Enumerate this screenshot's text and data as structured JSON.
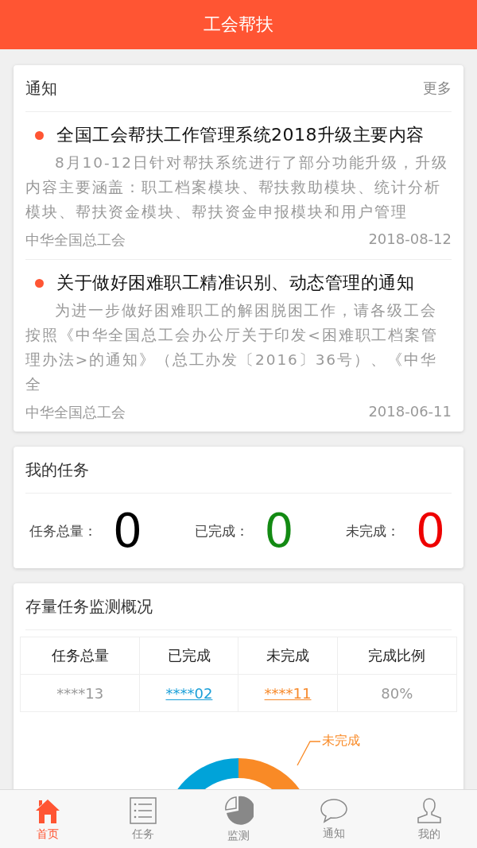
{
  "header": {
    "title": "工会帮扶"
  },
  "notices": {
    "title": "通知",
    "more": "更多",
    "items": [
      {
        "title": "全国工会帮扶工作管理系统2018升级主要内容",
        "summary": "8月10-12日针对帮扶系统进行了部分功能升级，升级内容主要涵盖：职工档案模块、帮扶救助模块、统计分析模块、帮扶资金模块、帮扶资金申报模块和用户管理",
        "source": "中华全国总工会",
        "date": "2018-08-12"
      },
      {
        "title": "关于做好困难职工精准识别、动态管理的通知",
        "summary": "为进一步做好困难职工的解困脱困工作，请各级工会按照《中华全国总工会办公厅关于印发<困难职工档案管理办法>的通知》（总工办发〔2016〕36号）、《中华全",
        "source": "中华全国总工会",
        "date": "2018-06-11"
      }
    ]
  },
  "my_tasks": {
    "title": "我的任务",
    "stats": [
      {
        "label": "任务总量：",
        "value": "0",
        "color": "#000000"
      },
      {
        "label": "已完成：",
        "value": "0",
        "color": "#138a13"
      },
      {
        "label": "未完成：",
        "value": "0",
        "color": "#ee0000"
      }
    ]
  },
  "monitoring": {
    "title": "存量任务监测概况",
    "table": {
      "columns": [
        "任务总量",
        "已完成",
        "未完成",
        "完成比例"
      ],
      "rows": [
        [
          {
            "text": "****13",
            "kind": "text",
            "color": "#999999"
          },
          {
            "text": "****02",
            "kind": "link",
            "color": "#1a9fd8"
          },
          {
            "text": "****11",
            "kind": "link",
            "color": "#f7892a"
          },
          {
            "text": "80%",
            "kind": "text",
            "color": "#999999"
          }
        ]
      ]
    },
    "chart_label": "未完成"
  },
  "tab_bar": [
    {
      "label": "首页",
      "selected": true
    },
    {
      "label": "任务",
      "selected": false
    },
    {
      "label": "监测",
      "selected": false
    },
    {
      "label": "通知",
      "selected": false
    },
    {
      "label": "我的",
      "selected": false
    }
  ]
}
